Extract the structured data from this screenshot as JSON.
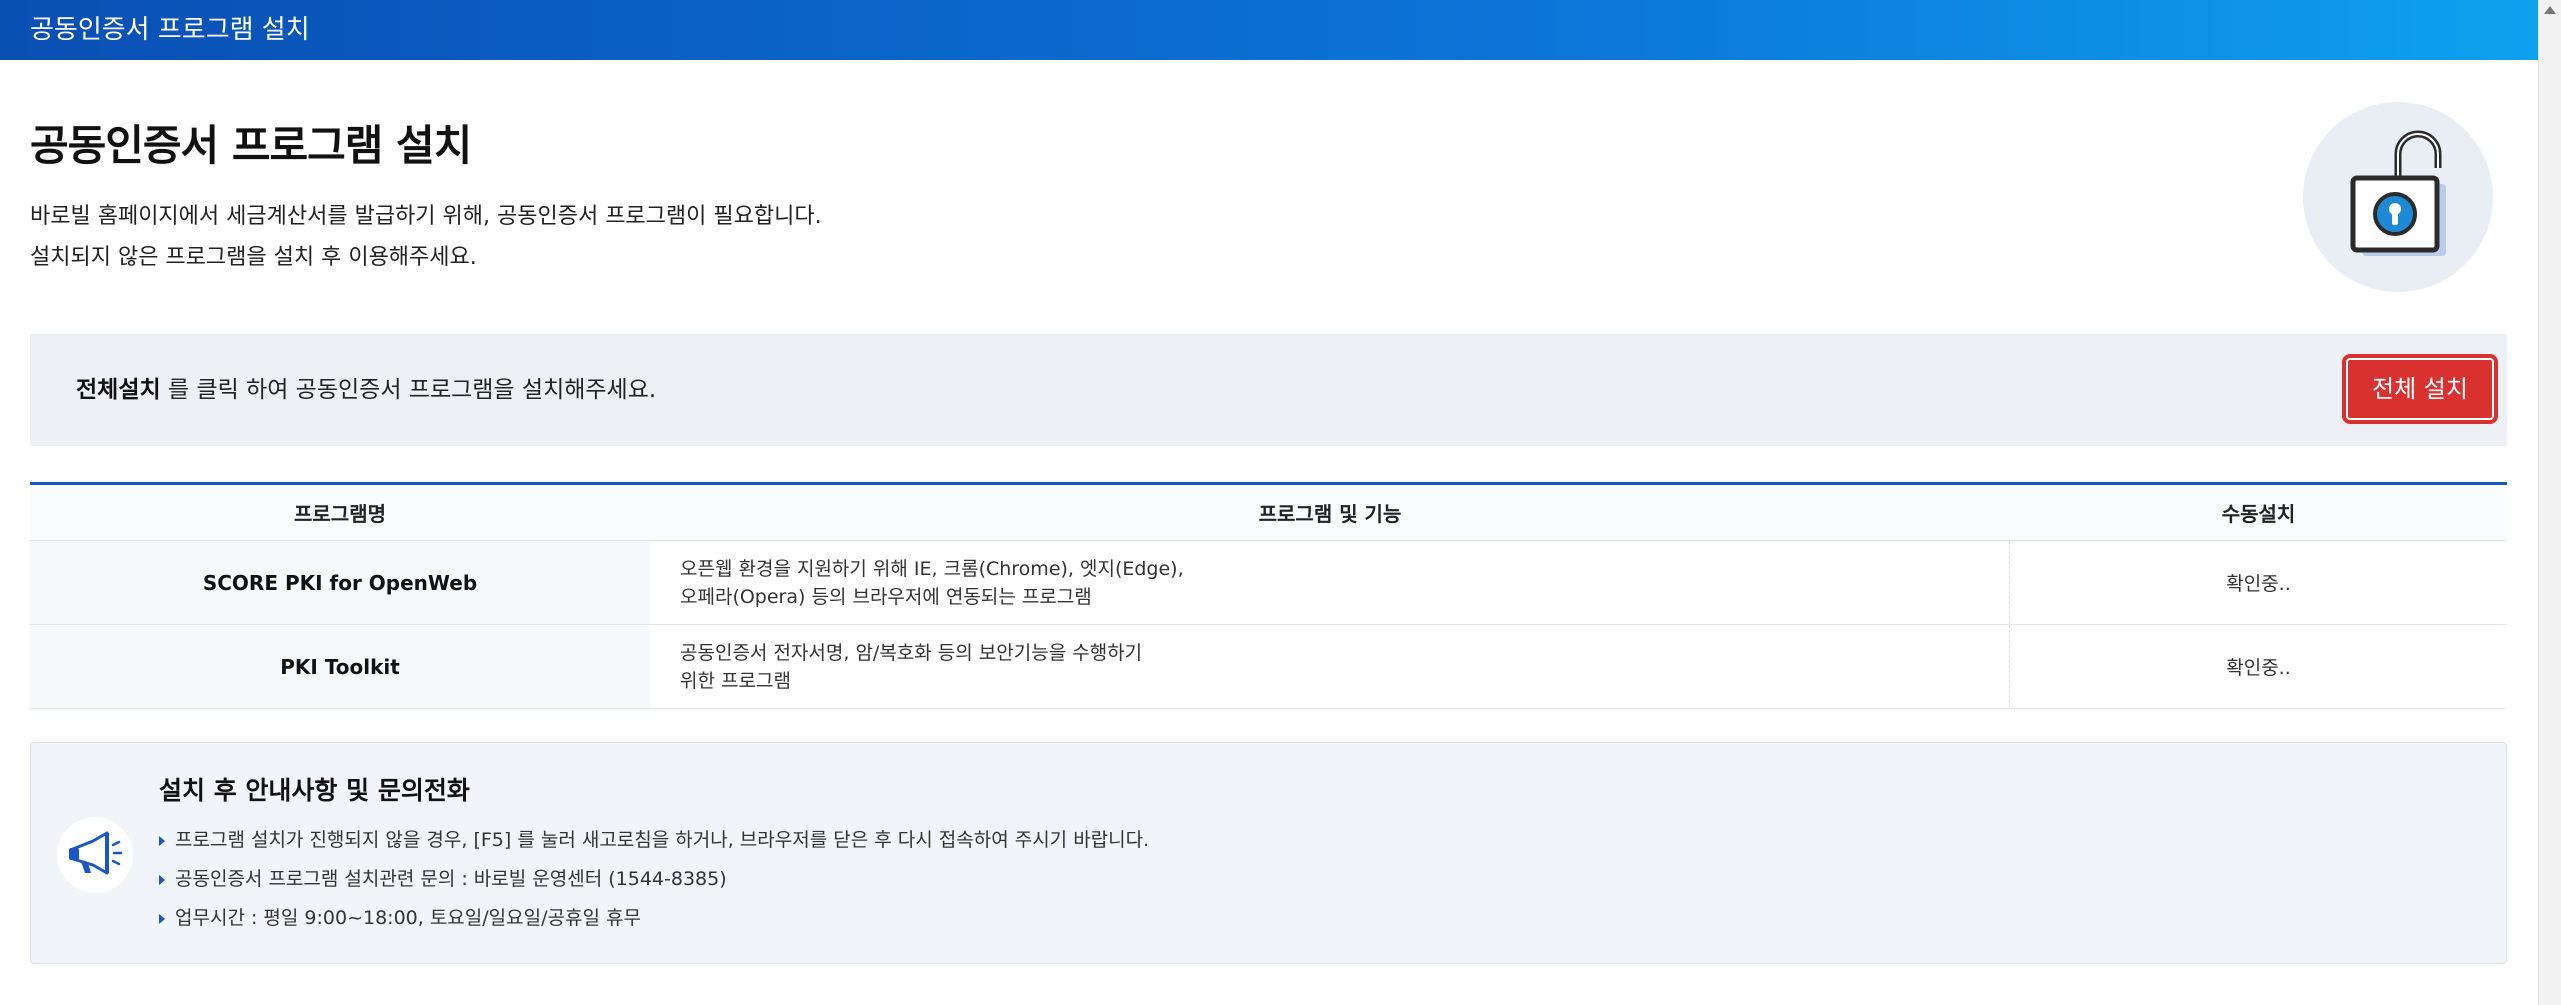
{
  "window": {
    "title": "공동인증서 프로그램 설치"
  },
  "header": {
    "title": "공동인증서 프로그램 설치",
    "desc_line1": "바로빌 홈페이지에서 세금계산서를 발급하기 위해, 공동인증서 프로그램이 필요합니다.",
    "desc_line2": "설치되지 않은 프로그램을 설치 후 이용해주세요.",
    "icon": "unlocked-padlock-icon"
  },
  "notice": {
    "strong": "전체설치",
    "text": " 를 클릭 하여 공동인증서 프로그램을 설치해주세요.",
    "button_label": "전체 설치"
  },
  "table": {
    "headers": [
      "프로그램명",
      "프로그램 및 기능",
      "수동설치"
    ],
    "rows": [
      {
        "name": "SCORE PKI for OpenWeb",
        "desc_line1": "오픈웹 환경을 지원하기 위해 IE, 크롬(Chrome), 엣지(Edge),",
        "desc_line2": "오페라(Opera) 등의 브라우저에 연동되는 프로그램",
        "status": "확인중.."
      },
      {
        "name": "PKI Toolkit",
        "desc_line1": "공동인증서 전자서명, 암/복호화 등의 보안기능을 수행하기",
        "desc_line2": "위한 프로그램",
        "status": "확인중.."
      }
    ]
  },
  "info": {
    "icon": "megaphone-icon",
    "title": "설치 후 안내사항 및 문의전화",
    "items": [
      "프로그램 설치가 진행되지 않을 경우, [F5] 를 눌러 새고로침을 하거나, 브라우저를 닫은 후 다시 접속하여 주시기 바랍니다.",
      "공동인증서 프로그램 설치관련 문의 : 바로빌 운영센터 (1544-8385)",
      "업무시간 : 평일 9:00~18:00, 토요일/일요일/공휴일 휴무"
    ]
  },
  "colors": {
    "accent": "#1a57c4",
    "button": "#d93030",
    "header_start": "#0a4fb4",
    "header_end": "#0ea1ee"
  }
}
